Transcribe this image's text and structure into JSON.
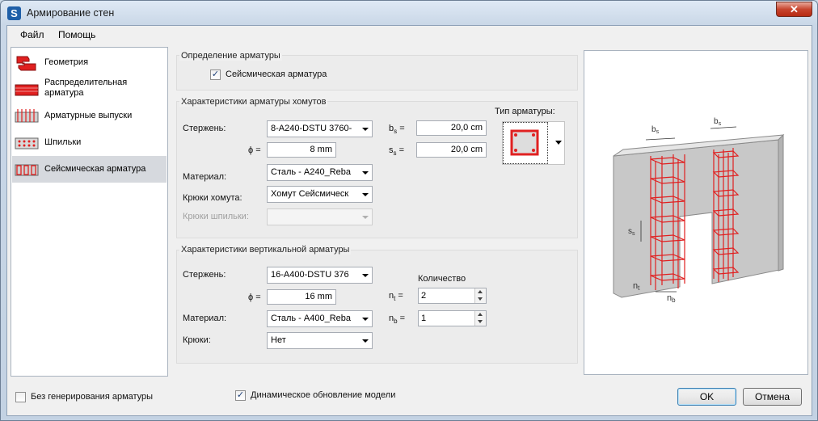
{
  "window": {
    "title": "Армирование стен",
    "icon_letter": "S",
    "close_label": "✕"
  },
  "menu": {
    "file": "Файл",
    "help": "Помощь"
  },
  "sidebar": {
    "items": [
      {
        "label": "Геометрия"
      },
      {
        "label": "Распределительная арматура"
      },
      {
        "label": "Арматурные выпуски"
      },
      {
        "label": "Шпильки"
      },
      {
        "label": "Сейсмическая арматура"
      }
    ]
  },
  "definition": {
    "title": "Определение арматуры",
    "seismic_label": "Сейсмическая арматура",
    "seismic_checked": true
  },
  "stirrups": {
    "title": "Характеристики арматуры хомутов",
    "bar_label": "Стержень:",
    "bar_value": "8-A240-DSTU 3760-",
    "phi_label": "ϕ =",
    "phi_value": "8 mm",
    "material_label": "Материал:",
    "material_value": "Сталь - A240_Reba",
    "hooks_label": "Крюки хомута:",
    "hooks_value": "Хомут Сейсмическ",
    "pin_hooks_label": "Крюки шпильки:",
    "pin_hooks_value": "",
    "bs_label": "b",
    "bs_sub": "s",
    "bs_value": "20,0 cm",
    "ss_label": "s",
    "ss_sub": "s",
    "ss_value": "20,0 cm",
    "eq": "=",
    "type_label": "Тип арматуры:"
  },
  "vertical": {
    "title": "Характеристики вертикальной арматуры",
    "bar_label": "Стержень:",
    "bar_value": "16-A400-DSTU 376",
    "phi_label": "ϕ =",
    "phi_value": "16 mm",
    "material_label": "Материал:",
    "material_value": "Сталь - A400_Reba",
    "hooks_label": "Крюки:",
    "hooks_value": "Нет",
    "count_label": "Количество",
    "nt_label": "n",
    "nt_sub": "t",
    "nt_value": "2",
    "nb_label": "n",
    "nb_sub": "b",
    "nb_value": "1",
    "eq": "="
  },
  "preview": {
    "bs_1": "b",
    "bs_1_sub": "s",
    "bs_2": "b",
    "bs_2_sub": "s",
    "ss": "s",
    "ss_sub": "s",
    "nt": "n",
    "nt_sub": "t",
    "nb": "n",
    "nb_sub": "b"
  },
  "footer": {
    "no_gen_label": "Без генерирования арматуры",
    "no_gen_checked": false,
    "dynamic_label": "Динамическое обновление модели",
    "dynamic_checked": true,
    "ok": "OK",
    "cancel": "Отмена"
  },
  "colors": {
    "rebar_red": "#e02020",
    "accent_blue": "#1f5fa8"
  }
}
